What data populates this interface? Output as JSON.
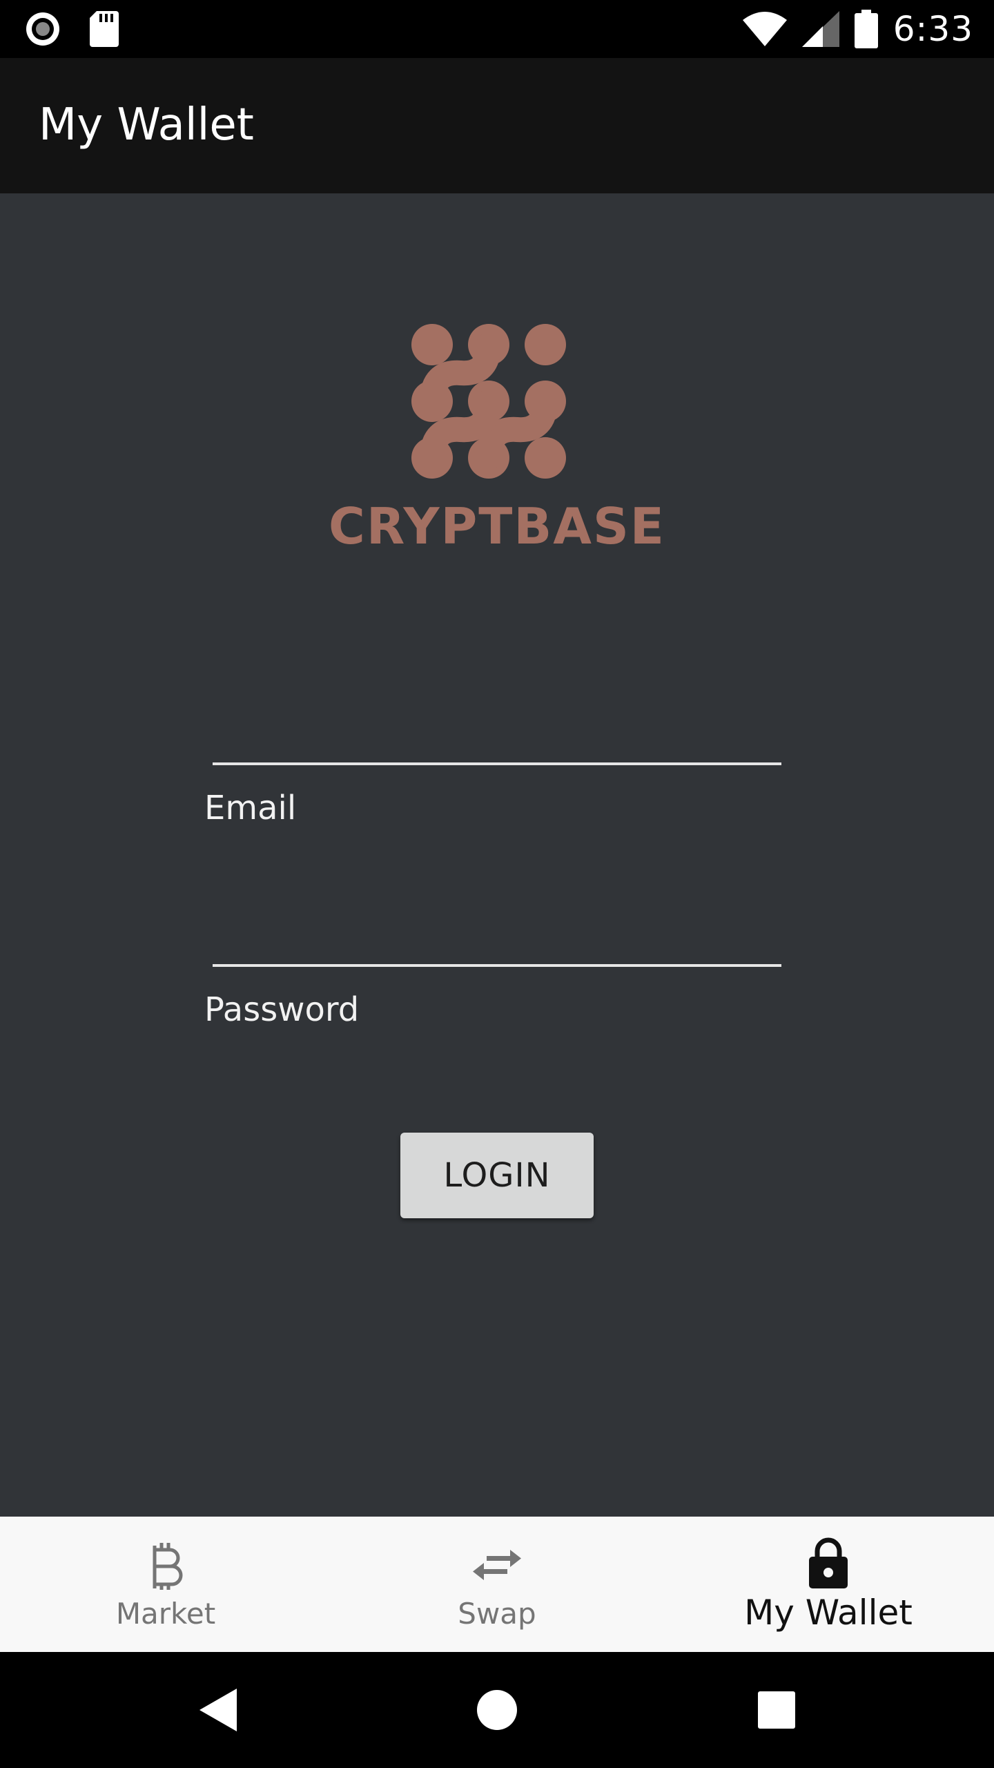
{
  "status_bar": {
    "time": "6:33",
    "icons": [
      "record-icon",
      "sd-card-icon",
      "wifi-icon",
      "signal-icon",
      "battery-icon"
    ]
  },
  "app_bar": {
    "title": "My Wallet"
  },
  "brand": {
    "name": "CRYPTBASE",
    "color": "#a47062"
  },
  "form": {
    "email": {
      "label": "Email",
      "value": ""
    },
    "password": {
      "label": "Password",
      "value": ""
    },
    "login_label": "LOGIN"
  },
  "bottom_nav": {
    "items": [
      {
        "label": "Market",
        "icon": "bitcoin-icon",
        "active": false
      },
      {
        "label": "Swap",
        "icon": "swap-arrows-icon",
        "active": false
      },
      {
        "label": "My Wallet",
        "icon": "lock-icon",
        "active": true
      }
    ]
  },
  "system_nav": {
    "buttons": [
      "back-icon",
      "home-icon",
      "recents-icon"
    ]
  },
  "colors": {
    "background": "#313438",
    "app_bar": "#131313",
    "accent": "#a47062",
    "nav_bg": "#f8f8f8"
  }
}
